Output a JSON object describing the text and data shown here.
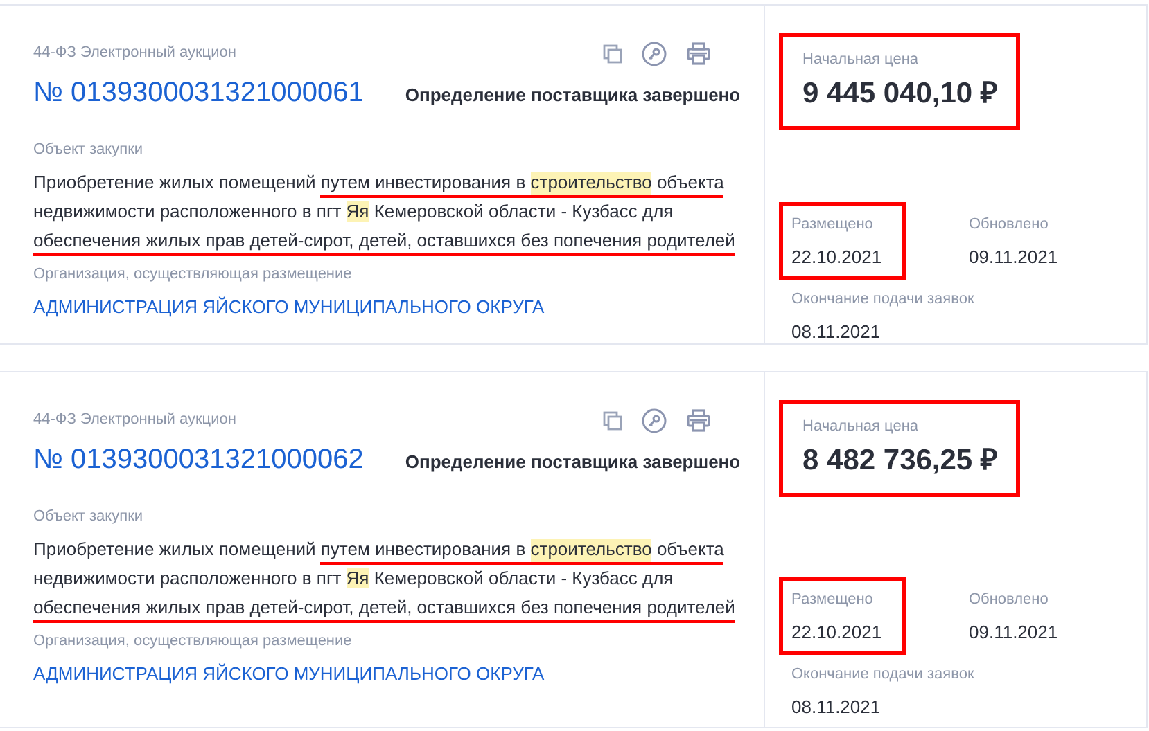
{
  "cards": [
    {
      "law": "44-ФЗ Электронный аукцион",
      "number": "№ 0139300031321000061",
      "status": "Определение поставщика завершено",
      "object_label": "Объект закупки",
      "description": [
        [
          {
            "text": "Приобретение жилых помещений ",
            "highlighted": false,
            "underlined": false
          },
          {
            "text": "путем инвестирования в ",
            "highlighted": false,
            "underlined": true
          },
          {
            "text": "строительство",
            "highlighted": true,
            "underlined": true
          },
          {
            "text": " объекта",
            "highlighted": false,
            "underlined": true
          }
        ],
        [
          {
            "text": "недвижимости расположенного в пгт ",
            "highlighted": false,
            "underlined": false
          },
          {
            "text": "Яя",
            "highlighted": true,
            "underlined": false
          },
          {
            "text": " Кемеровской области - Кузбасс для",
            "highlighted": false,
            "underlined": false
          }
        ],
        [
          {
            "text": "обеспечения жилых прав детей-сирот, детей, оставшихся без попечения родителей",
            "highlighted": false,
            "underlined": true
          }
        ]
      ],
      "org_label": "Организация, осуществляющая размещение",
      "org": "АДМИНИСТРАЦИЯ ЯЙСКОГО МУНИЦИПАЛЬНОГО ОКРУГА",
      "price_label": "Начальная цена",
      "price": "9 445 040,10 ₽",
      "price_framed": true,
      "dates": [
        {
          "label": "Размещено",
          "value": "22.10.2021",
          "framed": true
        },
        {
          "label": "Обновлено",
          "value": "09.11.2021",
          "framed": false
        },
        {
          "label": "Окончание подачи заявок",
          "value": "08.11.2021",
          "framed": false
        }
      ]
    },
    {
      "law": "44-ФЗ Электронный аукцион",
      "number": "№ 0139300031321000062",
      "status": "Определение поставщика завершено",
      "object_label": "Объект закупки",
      "description": [
        [
          {
            "text": "Приобретение жилых помещений ",
            "highlighted": false,
            "underlined": false
          },
          {
            "text": "путем инвестирования в ",
            "highlighted": false,
            "underlined": true
          },
          {
            "text": "строительство",
            "highlighted": true,
            "underlined": true
          },
          {
            "text": " объекта",
            "highlighted": false,
            "underlined": true
          }
        ],
        [
          {
            "text": "недвижимости расположенного в пгт ",
            "highlighted": false,
            "underlined": false
          },
          {
            "text": "Яя",
            "highlighted": true,
            "underlined": false
          },
          {
            "text": " Кемеровской области - Кузбасс для",
            "highlighted": false,
            "underlined": false
          }
        ],
        [
          {
            "text": "обеспечения жилых прав детей-сирот, детей, оставшихся без попечения родителей",
            "highlighted": false,
            "underlined": true
          }
        ]
      ],
      "org_label": "Организация, осуществляющая размещение",
      "org": "АДМИНИСТРАЦИЯ ЯЙСКОГО МУНИЦИПАЛЬНОГО ОКРУГА",
      "price_label": "Начальная цена",
      "price": "8 482 736,25 ₽",
      "price_framed": true,
      "dates": [
        {
          "label": "Размещено",
          "value": "22.10.2021",
          "framed": true
        },
        {
          "label": "Обновлено",
          "value": "09.11.2021",
          "framed": false
        },
        {
          "label": "Окончание подачи заявок",
          "value": "08.11.2021",
          "framed": false
        }
      ]
    }
  ]
}
